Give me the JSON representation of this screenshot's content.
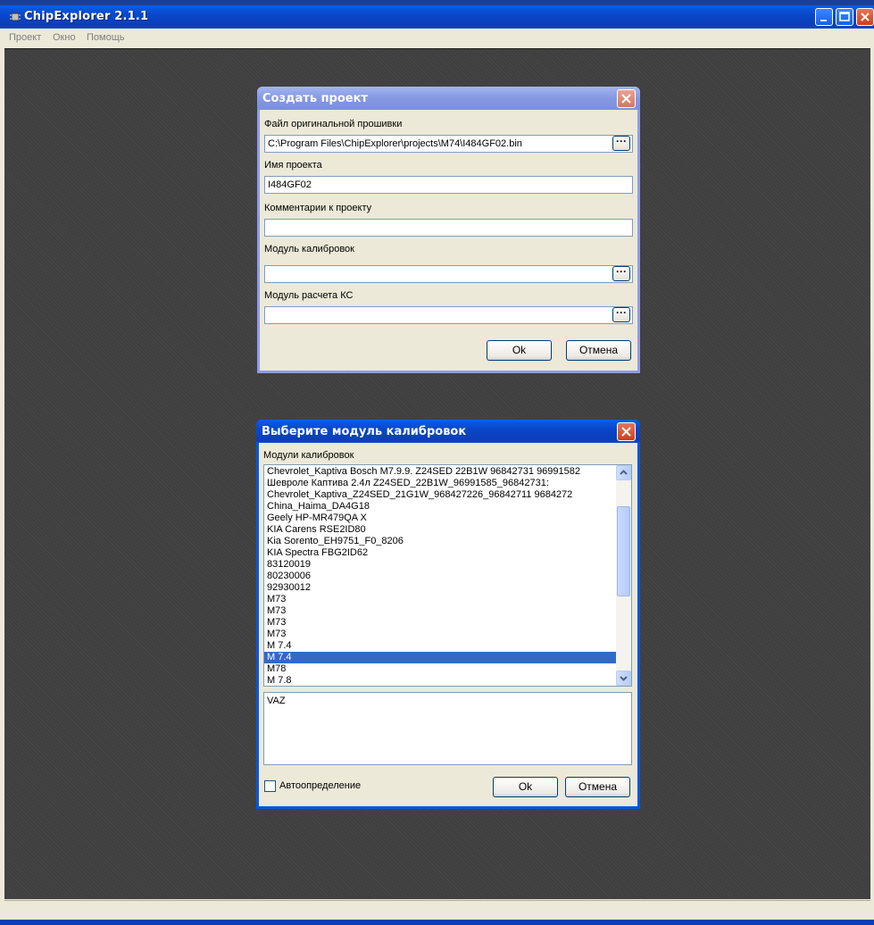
{
  "app": {
    "title": "ChipExplorer 2.1.1"
  },
  "menu": {
    "items": [
      "Проект",
      "Окно",
      "Помощь"
    ]
  },
  "create_project_dialog": {
    "title": "Создать проект",
    "firmware_label": "Файл оригинальной прошивки",
    "firmware_value": "C:\\Program Files\\ChipExplorer\\projects\\M74\\I484GF02.bin",
    "name_label": "Имя проекта",
    "name_value": "I484GF02",
    "comments_label": "Комментарии к проекту",
    "comments_value": "",
    "calib_label": "Модуль калибровок",
    "calib_value": "",
    "checksum_label": "Модуль расчета КС",
    "checksum_value": "",
    "ok_label": "Ok",
    "cancel_label": "Отмена",
    "browse_label": "···"
  },
  "select_module_dialog": {
    "title": "Выберите модуль калибровок",
    "list_label": "Модули калибровок",
    "modules": [
      "Chevrolet_Kaptiva Bosch M7.9.9. Z24SED 22B1W  96842731 96991582",
      "Шевроле Каптива 2.4л Z24SED_22B1W_96991585_96842731:",
      "Chevrolet_Kaptiva_Z24SED_21G1W_968427226_96842711 9684272",
      "China_Haima_DA4G18",
      "Geely HP-MR479QA X",
      " KIA Carens RSE2ID80",
      "Kia Sorento_EH9751_F0_8206",
      "KIA Spectra FBG2ID62",
      "83120019",
      "80230006",
      "92930012",
      "M73",
      "M73",
      "M73",
      "M73",
      "M 7.4",
      "M 7.4",
      "M78",
      "M 7.8"
    ],
    "selected_index": 16,
    "description": "VAZ",
    "auto_detect_label": "Автоопределение",
    "auto_detect_checked": false,
    "ok_label": "Ok",
    "cancel_label": "Отмена"
  }
}
